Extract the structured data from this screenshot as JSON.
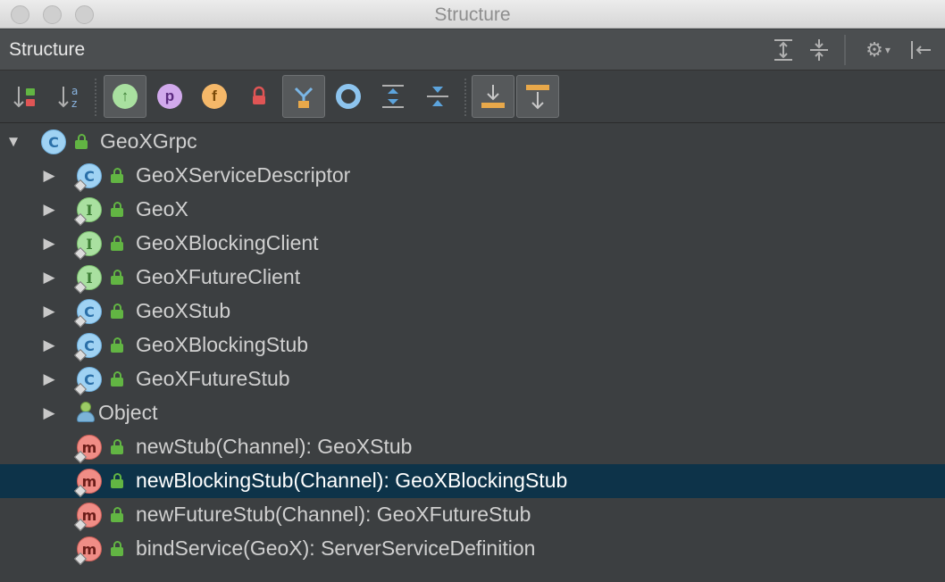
{
  "window": {
    "title": "Structure"
  },
  "panel": {
    "title": "Structure"
  },
  "header_icons": [
    "expand-all-icon",
    "collapse-all-icon",
    "gear-icon",
    "hide-panel-icon"
  ],
  "toolbar": {
    "sort_visibility": "sort-by-visibility-icon",
    "sort_alpha": "sort-alphabetically-icon",
    "inherited": "show-inherited-icon",
    "properties_letter": "p",
    "fields_letter": "f",
    "non_public": "show-non-public-icon",
    "group": "group-icon",
    "anonymous": "show-anonymous-icon",
    "expand": "expand-icon",
    "collapse": "collapse-icon",
    "autoscroll_to": "autoscroll-to-source-icon",
    "autoscroll_from": "autoscroll-from-source-icon"
  },
  "colors": {
    "background": "#3c3f41",
    "selection": "#0d3349",
    "class_icon": "#9fd2f3",
    "interface_icon": "#a9e0a0",
    "method_icon": "#f08d86",
    "public_lock": "#62b543"
  },
  "tree": {
    "root": {
      "label": "GeoXGrpc",
      "kind": "C"
    },
    "items": [
      {
        "label": "GeoXServiceDescriptor",
        "kind": "C"
      },
      {
        "label": "GeoX",
        "kind": "I"
      },
      {
        "label": "GeoXBlockingClient",
        "kind": "I"
      },
      {
        "label": "GeoXFutureClient",
        "kind": "I"
      },
      {
        "label": "GeoXStub",
        "kind": "C"
      },
      {
        "label": "GeoXBlockingStub",
        "kind": "C"
      },
      {
        "label": "GeoXFutureStub",
        "kind": "C"
      },
      {
        "label": "Object",
        "kind": "object"
      },
      {
        "label": "newStub(Channel): GeoXStub",
        "kind": "m"
      },
      {
        "label": "newBlockingStub(Channel): GeoXBlockingStub",
        "kind": "m",
        "selected": true
      },
      {
        "label": "newFutureStub(Channel): GeoXFutureStub",
        "kind": "m"
      },
      {
        "label": "bindService(GeoX): ServerServiceDefinition",
        "kind": "m"
      }
    ]
  }
}
